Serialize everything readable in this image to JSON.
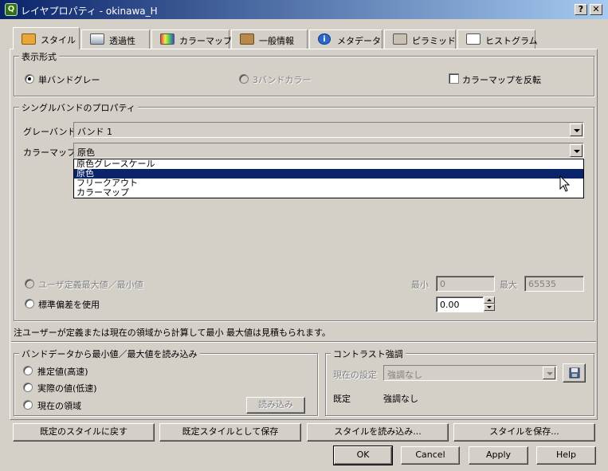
{
  "window": {
    "title": "レイヤプロパティ - okinawa_H",
    "help_btn": "?",
    "close_btn": "✕"
  },
  "tabs": [
    {
      "label": "スタイル",
      "icon": "brush-icon",
      "active": true
    },
    {
      "label": "透過性",
      "icon": "transparency-icon"
    },
    {
      "label": "カラーマップ",
      "icon": "colormap-icon"
    },
    {
      "label": "一般情報",
      "icon": "tools-icon"
    },
    {
      "label": "メタデータ",
      "icon": "info-icon"
    },
    {
      "label": "ピラミッド",
      "icon": "pyramid-icon"
    },
    {
      "label": "ヒストグラム",
      "icon": "histogram-icon"
    }
  ],
  "display": {
    "legend": "表示形式",
    "single_band": "単バンドグレー",
    "three_band": "3バンドカラー",
    "invert_colormap": "カラーマップを反転"
  },
  "single_band_props": {
    "legend": "シングルバンドのプロパティ",
    "gray_band_label": "グレーバンド",
    "gray_band_value": "バンド 1",
    "colormap_label": "カラーマップ",
    "colormap_value": "原色",
    "colormap_options": [
      "原色グレースケール",
      "原色",
      "フリークアウト",
      "カラーマップ"
    ],
    "user_defined_minmax": "ユーザ定義最大値／最小値",
    "min_label": "最小",
    "min_value": "0",
    "max_label": "最大",
    "max_value": "65535",
    "use_stddev": "標準偏差を使用",
    "stddev_value": "0.00"
  },
  "note": "注ユーザーが定義または現在の領域から計算して最小  最大値は見積もられます。",
  "load_minmax": {
    "legend": "バンドデータから最小値／最大値を読み込み",
    "estimate": "推定値(高速)",
    "actual": "実際の値(低速)",
    "current_extent": "現在の領域",
    "load_button": "読み込み"
  },
  "contrast": {
    "legend": "コントラスト強調",
    "current_label": "現在の設定",
    "current_value": "強調なし",
    "default_label": "既定",
    "default_value": "強調なし"
  },
  "style_buttons": {
    "restore_default": "既定のスタイルに戻す",
    "save_default": "既定スタイルとして保存",
    "load_style": "スタイルを読み込み...",
    "save_style": "スタイルを保存..."
  },
  "dialog_buttons": {
    "ok": "OK",
    "cancel": "Cancel",
    "apply": "Apply",
    "help": "Help"
  }
}
